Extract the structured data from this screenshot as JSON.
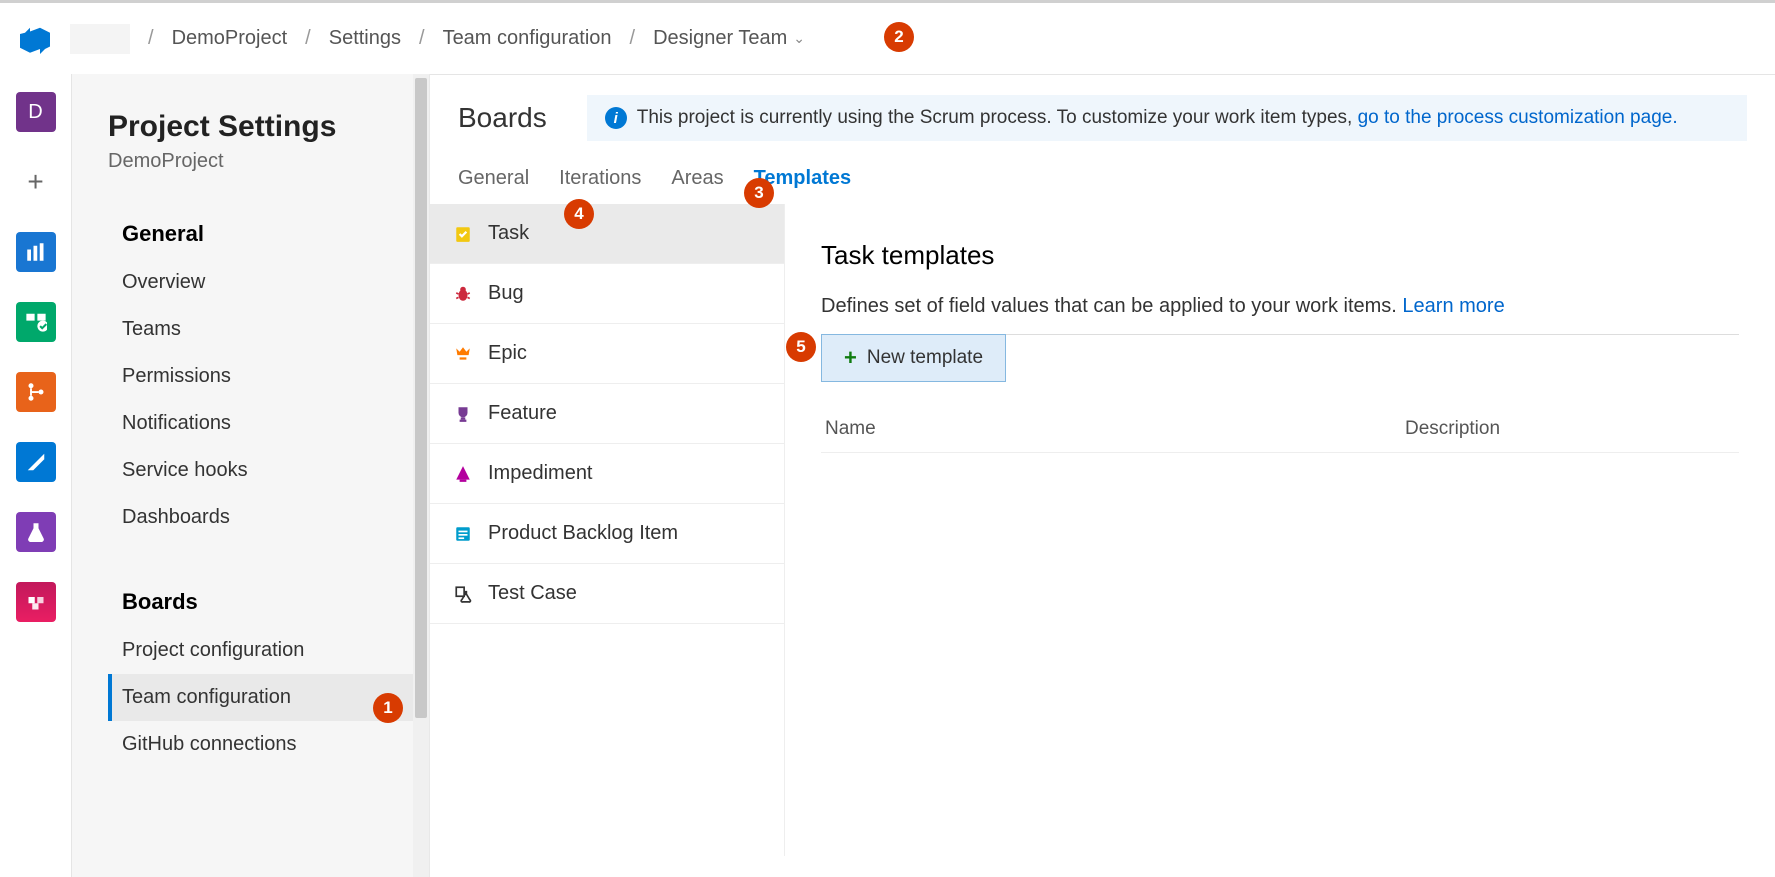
{
  "breadcrumb": {
    "project": "DemoProject",
    "settings": "Settings",
    "teamconfig": "Team configuration",
    "team": "Designer Team"
  },
  "sidebar": {
    "title": "Project Settings",
    "subtitle": "DemoProject",
    "groups": {
      "general": {
        "label": "General",
        "items": [
          "Overview",
          "Teams",
          "Permissions",
          "Notifications",
          "Service hooks",
          "Dashboards"
        ]
      },
      "boards": {
        "label": "Boards",
        "items": [
          "Project configuration",
          "Team configuration",
          "GitHub connections"
        ]
      }
    }
  },
  "main": {
    "heading": "Boards",
    "banner_text": "This project is currently using the Scrum process. To customize your work item types, ",
    "banner_link": "go to the process customization page.",
    "tabs": [
      "General",
      "Iterations",
      "Areas",
      "Templates"
    ],
    "wit_items": [
      "Task",
      "Bug",
      "Epic",
      "Feature",
      "Impediment",
      "Product Backlog Item",
      "Test Case"
    ],
    "templates": {
      "title": "Task templates",
      "desc": "Defines set of field values that can be applied to your work items. ",
      "learn_more": "Learn more",
      "new_button": "New template",
      "col_name": "Name",
      "col_desc": "Description"
    }
  },
  "callouts": [
    "1",
    "2",
    "3",
    "4",
    "5"
  ]
}
